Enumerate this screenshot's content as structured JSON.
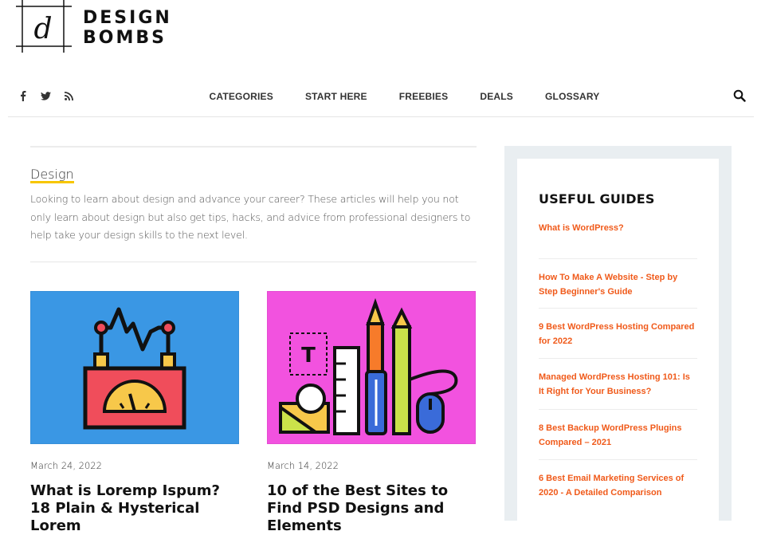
{
  "logo": {
    "line1": "DESIGN",
    "line2": "BOMBS",
    "mark_letter": "d"
  },
  "social": [
    {
      "icon": "facebook-icon",
      "glyph": "f"
    },
    {
      "icon": "twitter-icon",
      "glyph": ""
    },
    {
      "icon": "rss-icon",
      "glyph": ""
    }
  ],
  "nav": {
    "items": [
      "CATEGORIES",
      "START HERE",
      "FREEBIES",
      "DEALS",
      "GLOSSARY"
    ],
    "search_icon": "search-icon"
  },
  "category": {
    "title": "Design",
    "description": "Looking to learn about design and advance your career? These articles will help you not only learn about design but also get tips, hacks, and advice from professional designers to help take your design skills to the next level."
  },
  "posts": [
    {
      "date": "March 24, 2022",
      "title": "What is Loremp Ispum? 18 Plain & Hysterical Lorem",
      "thumb_bg": "#3a97e4",
      "thumb_icon": "gauge-device-icon"
    },
    {
      "date": "March 14, 2022",
      "title": "10 of the Best Sites to Find PSD Designs and Elements",
      "thumb_bg": "#f252df",
      "thumb_icon": "design-tools-icon"
    }
  ],
  "sidebar": {
    "heading": "USEFUL GUIDES",
    "guides": [
      "What is WordPress?",
      "How To Make A Website - Step by Step Beginner's Guide",
      "9 Best WordPress Hosting Compared for 2022",
      "Managed WordPress Hosting 101: Is It Right for Your Business?",
      "8 Best Backup WordPress Plugins Compared – 2021",
      "6 Best Email Marketing Services of 2020 - A Detailed Comparison"
    ]
  },
  "colors": {
    "accent": "#f05a1a",
    "underline": "#f7c600",
    "sidebar_bg": "#e9eef1"
  }
}
